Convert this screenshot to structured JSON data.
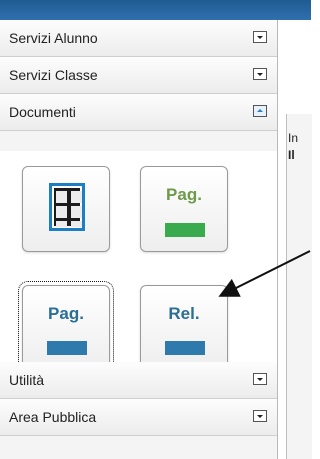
{
  "sidebar": {
    "sections": [
      {
        "label": "Servizi Alunno",
        "state": "collapsed"
      },
      {
        "label": "Servizi Classe",
        "state": "collapsed"
      },
      {
        "label": "Documenti",
        "state": "expanded"
      },
      {
        "label": "Utilità",
        "state": "collapsed"
      },
      {
        "label": "Area Pubblica",
        "state": "collapsed"
      }
    ],
    "documents": {
      "tiles": [
        {
          "icon": "document-grid-icon"
        },
        {
          "label": "Pag.",
          "bar_color": "#3aaa4f"
        },
        {
          "label": "Pag.",
          "bar_color": "#2f7aac"
        },
        {
          "label": "Rel.",
          "bar_color": "#2f7aac"
        }
      ]
    }
  },
  "right_pane": {
    "line1": "In",
    "line2": "Il"
  },
  "colors": {
    "accent": "#2f7aac",
    "green": "#3aaa4f",
    "topbar": "#2f6fad"
  }
}
